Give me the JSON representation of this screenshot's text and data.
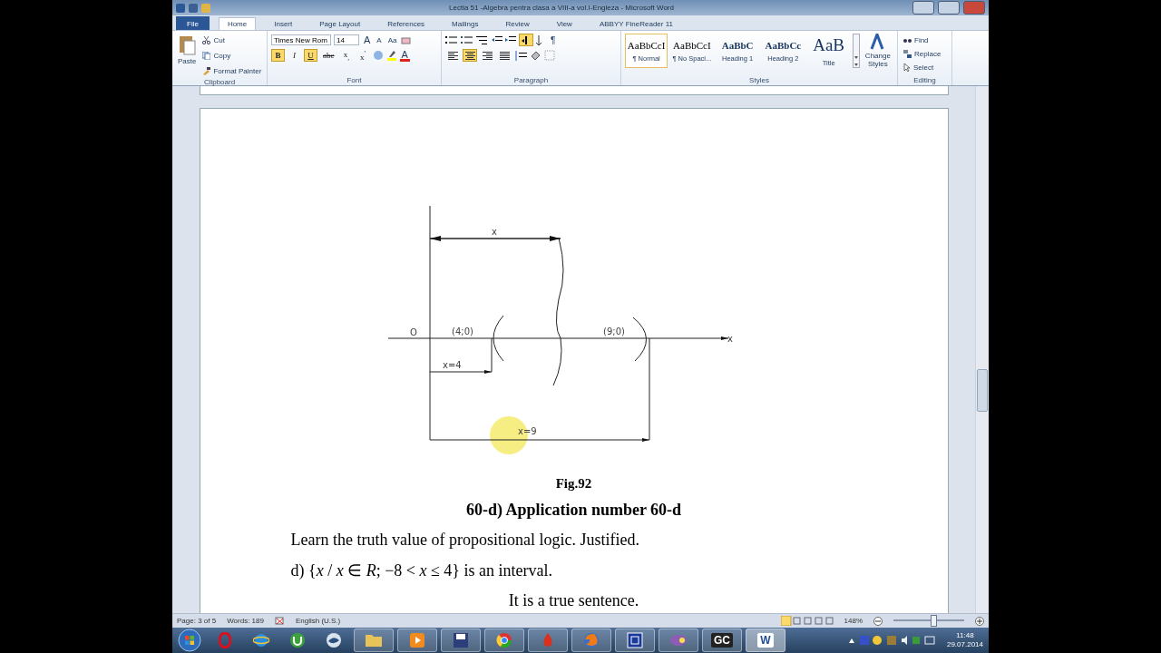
{
  "title_bar": {
    "title": "Lectia 51 -Algebra pentra clasa a VIII-a vol.I-Engleza  -  Microsoft Word"
  },
  "tabs": [
    {
      "label": "File",
      "kind": "file",
      "selected": false
    },
    {
      "label": "Home",
      "kind": "tab",
      "selected": true
    },
    {
      "label": "Insert",
      "kind": "tab",
      "selected": false
    },
    {
      "label": "Page Layout",
      "kind": "tab",
      "selected": false
    },
    {
      "label": "References",
      "kind": "tab",
      "selected": false
    },
    {
      "label": "Mailings",
      "kind": "tab",
      "selected": false
    },
    {
      "label": "Review",
      "kind": "tab",
      "selected": false
    },
    {
      "label": "View",
      "kind": "tab",
      "selected": false
    },
    {
      "label": "ABBYY FineReader 11",
      "kind": "tab",
      "selected": false
    }
  ],
  "ribbon": {
    "clipboard": {
      "label": "Clipboard",
      "paste": "Paste",
      "cut": "Cut",
      "copy": "Copy",
      "format_painter": "Format Painter"
    },
    "font": {
      "label": "Font",
      "name": "Times New Rom",
      "size": "14",
      "grow": "A",
      "shrink": "A",
      "change_case": "Aa",
      "formats": [
        {
          "label": "B",
          "kind": "bold",
          "selected": true
        },
        {
          "label": "I",
          "kind": "italic",
          "selected": false
        },
        {
          "label": "U",
          "kind": "underline",
          "selected": true
        },
        {
          "label": "abe",
          "kind": "strike",
          "selected": false
        },
        {
          "label": "x$_{,}$",
          "kind": "sub",
          "selected": false
        },
        {
          "label": "x$^{'}$",
          "kind": "sup",
          "selected": false
        }
      ],
      "font_color": "A"
    },
    "paragraph": {
      "label": "Paragraph",
      "ltr_selected": true,
      "show_marks": "¶",
      "alignments": [
        {
          "selected": false
        },
        {
          "selected": true
        },
        {
          "selected": false
        },
        {
          "selected": false
        }
      ]
    },
    "styles": {
      "label": "Styles",
      "change_styles": "Change Styles",
      "items": [
        {
          "sample": "AaBbCcI",
          "name": "¶ Normal",
          "kind": "normal",
          "selected": true
        },
        {
          "sample": "AaBbCcI",
          "name": "¶ No Spaci...",
          "kind": "normal",
          "selected": false
        },
        {
          "sample": "AaBbC",
          "name": "Heading 1",
          "kind": "heading1",
          "selected": false
        },
        {
          "sample": "AaBbCc",
          "name": "Heading 2",
          "kind": "heading2",
          "selected": false
        },
        {
          "sample": "AaB",
          "name": "Title",
          "kind": "title",
          "selected": false
        }
      ]
    },
    "editing": {
      "label": "Editing",
      "find": "Find",
      "replace": "Replace",
      "select": "Select"
    }
  },
  "document": {
    "figure": {
      "top_label": "x",
      "origin": "O",
      "point_a": "(4;0)",
      "point_b": "(9;0)",
      "axis_label": "x",
      "label_a": "x=4",
      "label_b": "x=9"
    },
    "caption": "Fig.92",
    "heading": "60-d) Application number 60-d",
    "paragraphs": [
      {
        "text": "Learn the truth value of propositional logic. Justified.",
        "kind": "left"
      },
      {
        "text": "d)  {*x* / *x* ∈ *R*;   −8 < *x* ≤ 4} is an interval.",
        "kind": "left"
      },
      {
        "text": "It is a true sentence.",
        "kind": "center"
      }
    ]
  },
  "status_bar": {
    "page": "Page: 3 of 5",
    "words": "Words: 189",
    "language": "English (U.S.)",
    "zoom": "148%",
    "zoom_slider": {
      "level": 0.56
    }
  },
  "taskbar": {
    "apps": [
      {
        "kind": "ring",
        "running": false,
        "selected": false
      },
      {
        "kind": "globe",
        "running": false,
        "selected": false
      },
      {
        "kind": "mu",
        "running": false,
        "selected": false
      },
      {
        "kind": "bird",
        "running": false,
        "selected": false
      },
      {
        "kind": "folder",
        "running": true,
        "selected": false
      },
      {
        "kind": "play",
        "running": true,
        "selected": false
      },
      {
        "kind": "floppy",
        "running": true,
        "selected": false
      },
      {
        "kind": "wheel",
        "running": true,
        "selected": false
      },
      {
        "kind": "flame",
        "running": true,
        "selected": false
      },
      {
        "kind": "fox",
        "running": true,
        "selected": false
      },
      {
        "kind": "frame",
        "running": true,
        "selected": false
      },
      {
        "kind": "chat",
        "running": true,
        "selected": false
      },
      {
        "kind": "text",
        "label": "GC",
        "running": true,
        "selected": false
      },
      {
        "kind": "text",
        "label": "W",
        "running": true,
        "selected": true
      }
    ],
    "time": "11:48",
    "date": "29.07.2014"
  }
}
